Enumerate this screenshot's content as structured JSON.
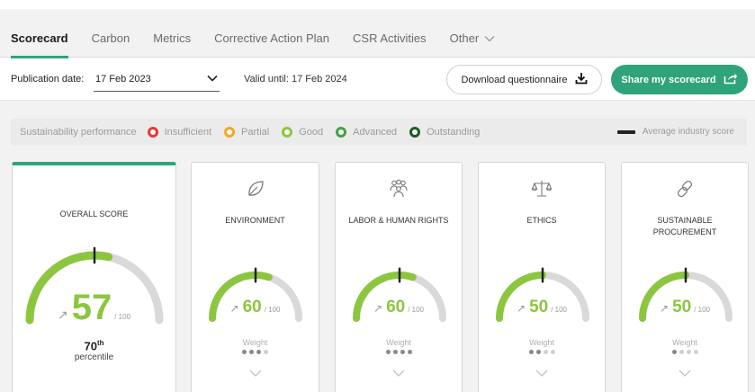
{
  "tabs": [
    {
      "label": "Scorecard",
      "active": true
    },
    {
      "label": "Carbon",
      "active": false
    },
    {
      "label": "Metrics",
      "active": false
    },
    {
      "label": "Corrective Action Plan",
      "active": false
    },
    {
      "label": "CSR Activities",
      "active": false
    },
    {
      "label": "Other",
      "active": false,
      "icon": "chevron-down-icon"
    }
  ],
  "toolbar": {
    "publication_label": "Publication date:",
    "publication_value": "17 Feb 2023",
    "valid_text": "Valid until: 17 Feb 2024",
    "download_label": "Download questionnaire",
    "share_label": "Share my scorecard"
  },
  "legend": {
    "title": "Sustainability performance",
    "items": [
      {
        "label": "Insufficient",
        "color": "#e53935"
      },
      {
        "label": "Partial",
        "color": "#f5a623"
      },
      {
        "label": "Good",
        "color": "#8cc63f"
      },
      {
        "label": "Advanced",
        "color": "#43a047"
      },
      {
        "label": "Outstanding",
        "color": "#1b5e20"
      }
    ],
    "average_label": "Average industry score"
  },
  "colors": {
    "accent": "#2fa37a",
    "score": "#8cc63f",
    "track": "#d9d9d9",
    "marker": "#222222"
  },
  "overall": {
    "title": "OVERALL SCORE",
    "score": "57",
    "score_value": 57,
    "industry_average": 50,
    "out_of": "/ 100",
    "percentile_value": "70",
    "percentile_suffix": "th",
    "percentile_label": "percentile",
    "trend_icon": "arrow-up-right-icon"
  },
  "themes": [
    {
      "key": "environment",
      "title": "ENVIRONMENT",
      "icon": "leaf-icon",
      "score": "60",
      "score_value": 60,
      "industry_average": 50,
      "out_of": "/ 100",
      "weight_label": "Weight",
      "weight_level": 3,
      "weight_max": 4
    },
    {
      "key": "labor",
      "title": "LABOR & HUMAN RIGHTS",
      "icon": "people-icon",
      "score": "60",
      "score_value": 60,
      "industry_average": 50,
      "out_of": "/ 100",
      "weight_label": "Weight",
      "weight_level": 4,
      "weight_max": 4
    },
    {
      "key": "ethics",
      "title": "ETHICS",
      "icon": "scales-icon",
      "score": "50",
      "score_value": 50,
      "industry_average": 50,
      "out_of": "/ 100",
      "weight_label": "Weight",
      "weight_level": 2,
      "weight_max": 4
    },
    {
      "key": "procurement",
      "title": "SUSTAINABLE PROCUREMENT",
      "icon": "chain-link-icon",
      "score": "50",
      "score_value": 50,
      "industry_average": 50,
      "out_of": "/ 100",
      "weight_label": "Weight",
      "weight_level": 1,
      "weight_max": 4
    }
  ]
}
